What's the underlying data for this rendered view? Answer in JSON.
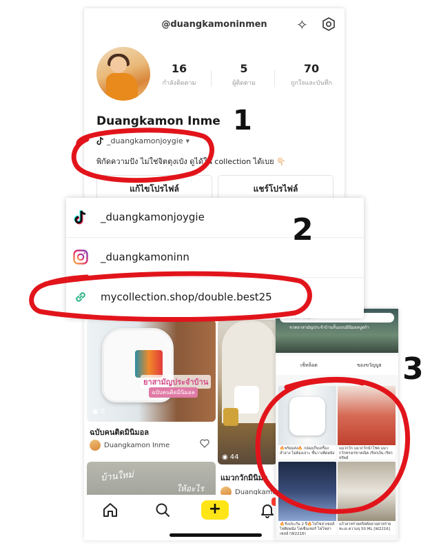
{
  "profile": {
    "handle": "@duangkamoninmen",
    "name": "Duangkamon Inme",
    "tiktok_handle": "_duangkamonjoygie",
    "bio": "พิกัดความปัง ไม่ใช่จิตตุงเป๋ง ดูได้ใน collection ได้เบย 👇🏻",
    "stats": [
      {
        "value": "16",
        "label": "กำลังติดตาม"
      },
      {
        "value": "5",
        "label": "ผู้ติดตาม"
      },
      {
        "value": "70",
        "label": "ถูกใจและบันทึก"
      }
    ],
    "edit_button": "แก้ไขโปรไฟล์",
    "share_button": "แชร์โปรไฟล์"
  },
  "annotations": {
    "one": "1",
    "two": "2",
    "three": "3"
  },
  "links": {
    "tiktok": "_duangkamonjoygie",
    "instagram": "_duangkamoninn",
    "website": "mycollection.shop/double.best25"
  },
  "feed": {
    "post1": {
      "overlay_title": "ยาสามัญประจำบ้าน",
      "overlay_sub": "ฉบับคนติดมินิมอล",
      "views": "0",
      "title": "ฉบับคนติดมินิมอล",
      "author": "Duangkamon Inme"
    },
    "post2": {
      "views": "44",
      "title": "แมวกวักมินิมอ",
      "author": "Duangkamon"
    },
    "post3": {
      "overlay_a": "บ้านใหม่",
      "overlay_b": "ให้อะไร"
    }
  },
  "shop": {
    "search_placeholder": "ค้นหาสินค้า",
    "banner_caption": "ขวดยาสามัญประจำบ้านกั้นแบบมินิมอลบูดก้า",
    "tabs": [
      "เซ็ทล็อต",
      "ของขวัญบูธ"
    ],
    "products": [
      "🔥พร้อมส่ง🔥 กล่องเก็บเครื่องสำอาง ไม่ต้องเจาะ ชั้นวางติดผนัง",
      "แมวกวัก แมวกวักนำโชค แมวกวักทรงเรขาคณิต เรียกเงิน เรียกทรัพย์",
      "🔥รับประกัน 2 ปี🔥ไฟโซล่าเซลล์ ไฟติดผนัง ไฟเซ็นเซอร์ ไฟโซล่าเซลล์ [W2216]",
      "แก้วสาหร่ายคริสตัลลายสาหร่ายทะเล ความจุ 50 ML [W2216]"
    ]
  },
  "colors": {
    "annotation_red": "#e2141b",
    "accent_yellow": "#ffe516",
    "link_green": "#2fb38a"
  }
}
